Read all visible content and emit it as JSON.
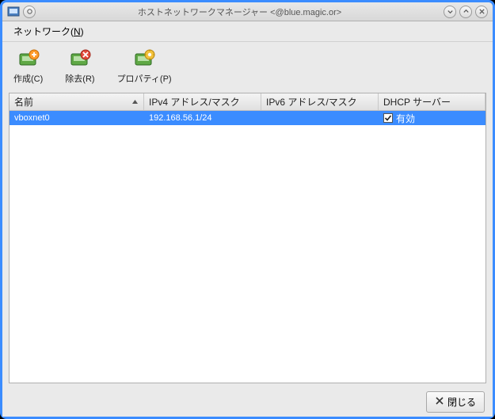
{
  "window": {
    "title": "ホストネットワークマネージャー <@blue.magic.or>"
  },
  "menubar": {
    "network": {
      "label": "ネットワーク(",
      "accel": "N",
      "suffix": ")"
    }
  },
  "toolbar": {
    "create": "作成(C)",
    "remove": "除去(R)",
    "properties": "プロパティ(P)"
  },
  "columns": {
    "name": "名前",
    "ipv4": "IPv4 アドレス/マスク",
    "ipv6": "IPv6 アドレス/マスク",
    "dhcp": "DHCP サーバー"
  },
  "rows": [
    {
      "name": "vboxnet0",
      "ipv4": "192.168.56.1/24",
      "ipv6": "",
      "dhcp_enabled": true,
      "dhcp_label": "有効"
    }
  ],
  "footer": {
    "close": "閉じる"
  }
}
